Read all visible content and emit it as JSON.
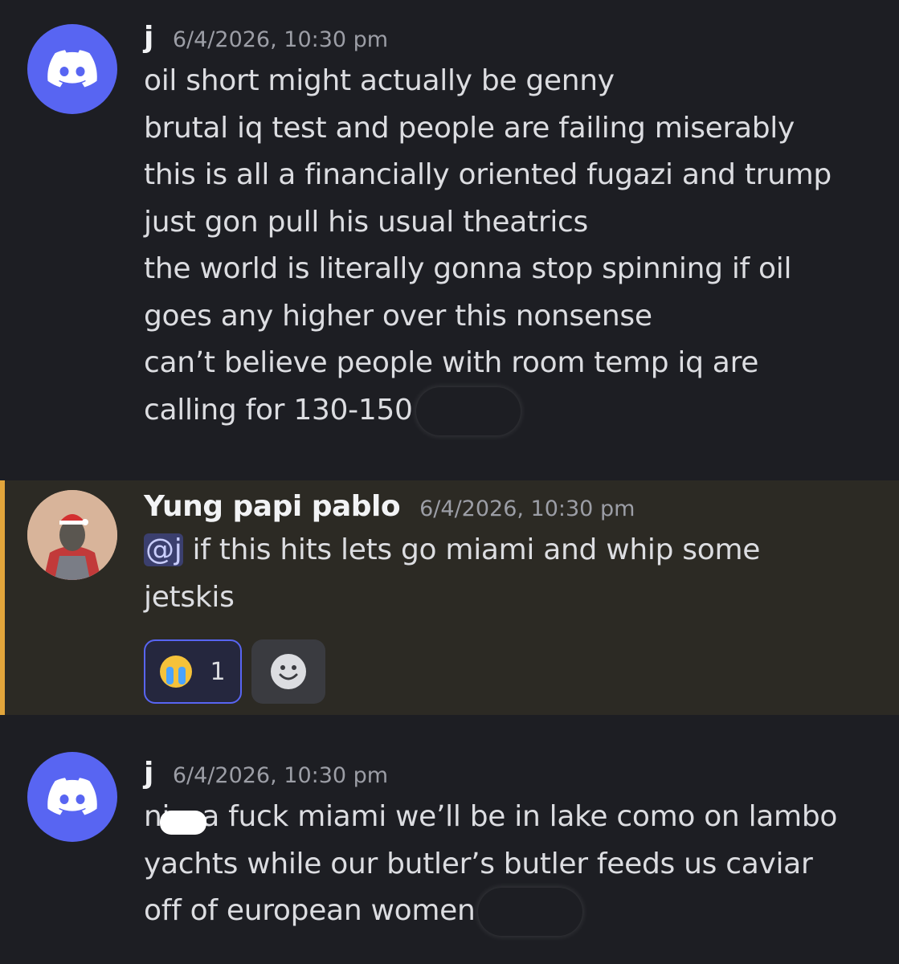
{
  "messages": [
    {
      "username": "j",
      "timestamp": "6/4/2026, 10:30 pm",
      "lines": [
        "oil short might actually be genny",
        "brutal iq test and people are failing miserably",
        "this is all a financially oriented fugazi and trump",
        "just gon pull his usual theatrics",
        "the world is literally gonna stop spinning if oil",
        "goes any higher over this nonsense",
        "can’t believe people with room temp iq are",
        "calling for 130-150"
      ],
      "avatar_icon": "discord-logo-icon"
    },
    {
      "username": "Yung papi pablo",
      "timestamp": "6/4/2026, 10:30 pm",
      "mention": "@j",
      "line1_rest": " if this hits lets go miami and whip some",
      "line2": "jetskis",
      "reaction": {
        "emoji": "crying-face-icon",
        "count": "1"
      },
      "add_reaction_icon": "smiley-icon",
      "highlight_color": "#e2a53b"
    },
    {
      "username": "j",
      "timestamp": "6/4/2026, 10:30 pm",
      "line1_start": "ni",
      "line1_rest": "a fuck miami we’ll be in lake como on lambo",
      "line2": "yachts while our butler’s butler feeds us caviar",
      "line3": "off of european women",
      "avatar_icon": "discord-logo-icon"
    }
  ]
}
